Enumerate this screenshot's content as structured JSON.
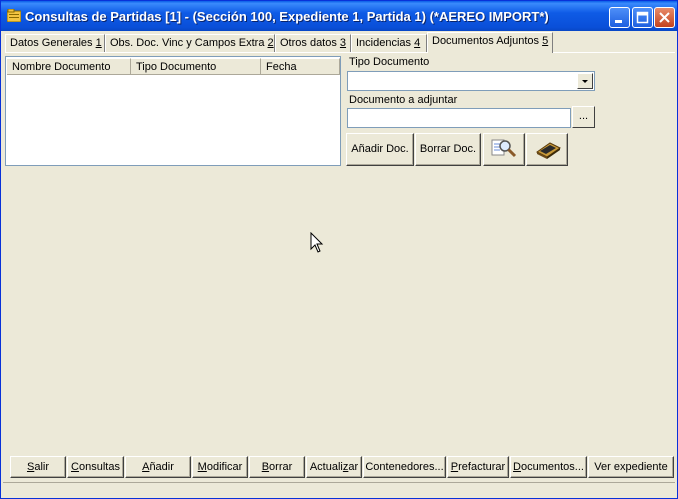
{
  "window": {
    "title": "Consultas de Partidas [1] - (Sección 100, Expediente 1, Partida 1) (*AEREO IMPORT*)",
    "controls": {
      "minimize_icon": "minimize-icon",
      "maximize_icon": "maximize-icon",
      "close_icon": "close-icon"
    }
  },
  "tabs": [
    {
      "label": "Datos Generales ",
      "accel": "1"
    },
    {
      "label": "Obs. Doc. Vinc y Campos Extra ",
      "accel": "2"
    },
    {
      "label": "Otros datos ",
      "accel": "3"
    },
    {
      "label": "Incidencias ",
      "accel": "4"
    },
    {
      "label": "Documentos Adjuntos ",
      "accel": "5"
    }
  ],
  "active_tab": "Documentos Adjuntos 5",
  "grid": {
    "columns": [
      "Nombre Documento",
      "Tipo Documento",
      "Fecha"
    ],
    "rows": []
  },
  "form": {
    "tipo_label": "Tipo Documento",
    "tipo_value": "",
    "adjuntar_label": "Documento a adjuntar",
    "adjuntar_value": "",
    "browse_label": "..."
  },
  "doc_buttons": {
    "add": "Añadir Doc.",
    "delete": "Borrar Doc.",
    "view_icon": "magnifier-document-icon",
    "scan_icon": "scanner-icon"
  },
  "bottom_buttons": [
    {
      "label": "Salir",
      "accel_index": 0
    },
    {
      "label": "Consultas",
      "accel_index": 0
    },
    {
      "label": "Añadir",
      "accel_index": 0
    },
    {
      "label": "Modificar",
      "accel_index": 0
    },
    {
      "label": "Borrar",
      "accel_index": 0
    },
    {
      "label": "Actualizar",
      "accel_index": 7
    },
    {
      "label": "Contenedores...",
      "accel_index": -1
    },
    {
      "label": "Prefacturar",
      "accel_index": 0
    },
    {
      "label": "Documentos...",
      "accel_index": 0
    },
    {
      "label": "Ver expediente",
      "accel_index": -1
    }
  ],
  "colors": {
    "titlebar": "#0A4FD8",
    "face": "#ECE9D8",
    "field_border": "#7F9DB9"
  }
}
